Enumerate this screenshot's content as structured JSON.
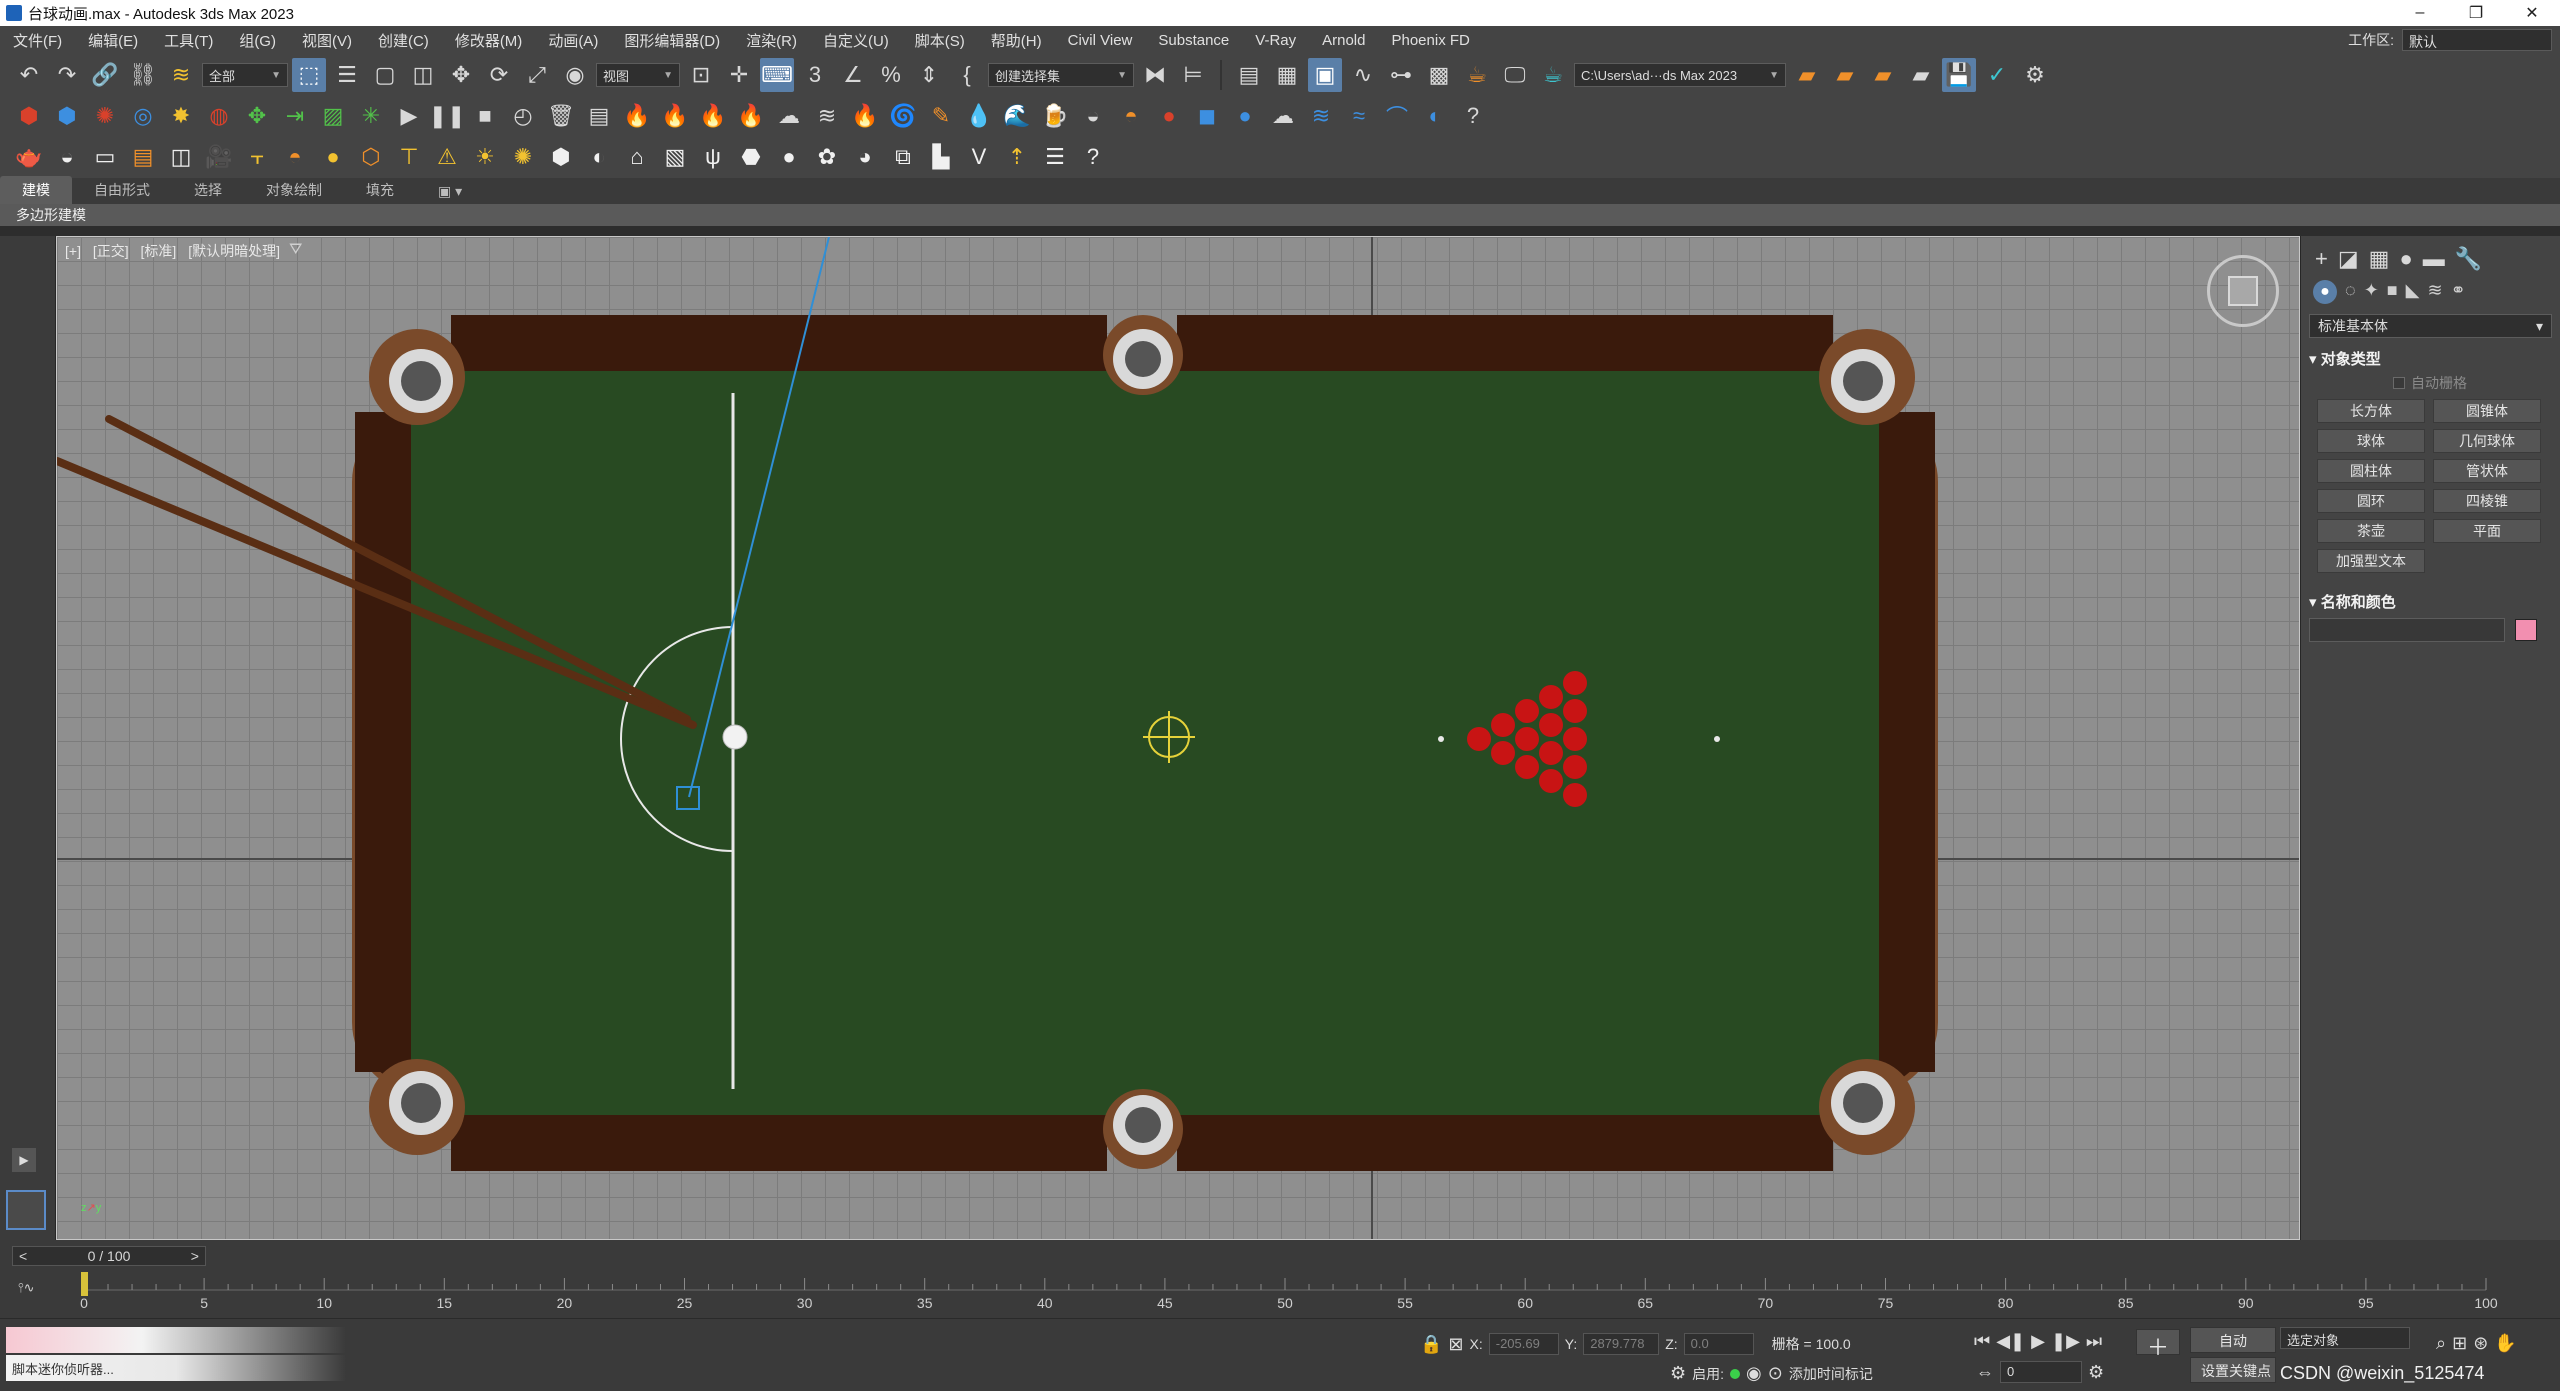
{
  "window": {
    "title": "台球动画.max - Autodesk 3ds Max 2023",
    "minimize": "–",
    "maximize": "❐",
    "close": "✕"
  },
  "menus": [
    "文件(F)",
    "编辑(E)",
    "工具(T)",
    "组(G)",
    "视图(V)",
    "创建(C)",
    "修改器(M)",
    "动画(A)",
    "图形编辑器(D)",
    "渲染(R)",
    "自定义(U)",
    "脚本(S)",
    "帮助(H)",
    "Civil View",
    "Substance",
    "V-Ray",
    "Arnold",
    "Phoenix FD"
  ],
  "workspace": {
    "label": "工作区:",
    "value": "默认"
  },
  "toolbar": {
    "selection_filter": "全部",
    "ref_coord": "视图",
    "named_selection": "创建选择集",
    "project_path": "C:\\Users\\ad···ds Max 2023"
  },
  "ribbon": {
    "tabs": [
      "建模",
      "自由形式",
      "选择",
      "对象绘制",
      "填充"
    ],
    "subtab": "多边形建模"
  },
  "viewport": {
    "labels": [
      "[+]",
      "[正交]",
      "[标准]",
      "[默认明暗处理]"
    ]
  },
  "command_panel": {
    "category": "标准基本体",
    "object_type_title": "对象类型",
    "autogrid": "自动栅格",
    "buttons": [
      "长方体",
      "圆锥体",
      "球体",
      "几何球体",
      "圆柱体",
      "管状体",
      "圆环",
      "四棱锥",
      "茶壶",
      "平面",
      "加强型文本"
    ],
    "name_color_title": "名称和颜色",
    "swatch_color": "#f28fb0"
  },
  "timeline": {
    "frame_display": "0 / 100",
    "ticks": [
      0,
      5,
      10,
      15,
      20,
      25,
      30,
      35,
      40,
      45,
      50,
      55,
      60,
      65,
      70,
      75,
      80,
      85,
      90,
      95,
      100
    ]
  },
  "status": {
    "x_label": "X:",
    "x_value": "-205.69",
    "y_label": "Y:",
    "y_value": "2879.778",
    "z_label": "Z:",
    "z_value": "0.0",
    "grid": "栅格 = 100.0",
    "enable_label": "启用:",
    "add_time_tag": "添加时间标记",
    "auto_key": "自动",
    "set_key": "设置关键点",
    "selected_object": "选定对象",
    "current_frame": "0",
    "script_text": "脚本迷你侦听器...",
    "watermark": "CSDN @weixin_5125474"
  },
  "colors": {
    "felt": "#284a22",
    "rail": "#3a1a0c",
    "accent": "#5a7fa8"
  }
}
